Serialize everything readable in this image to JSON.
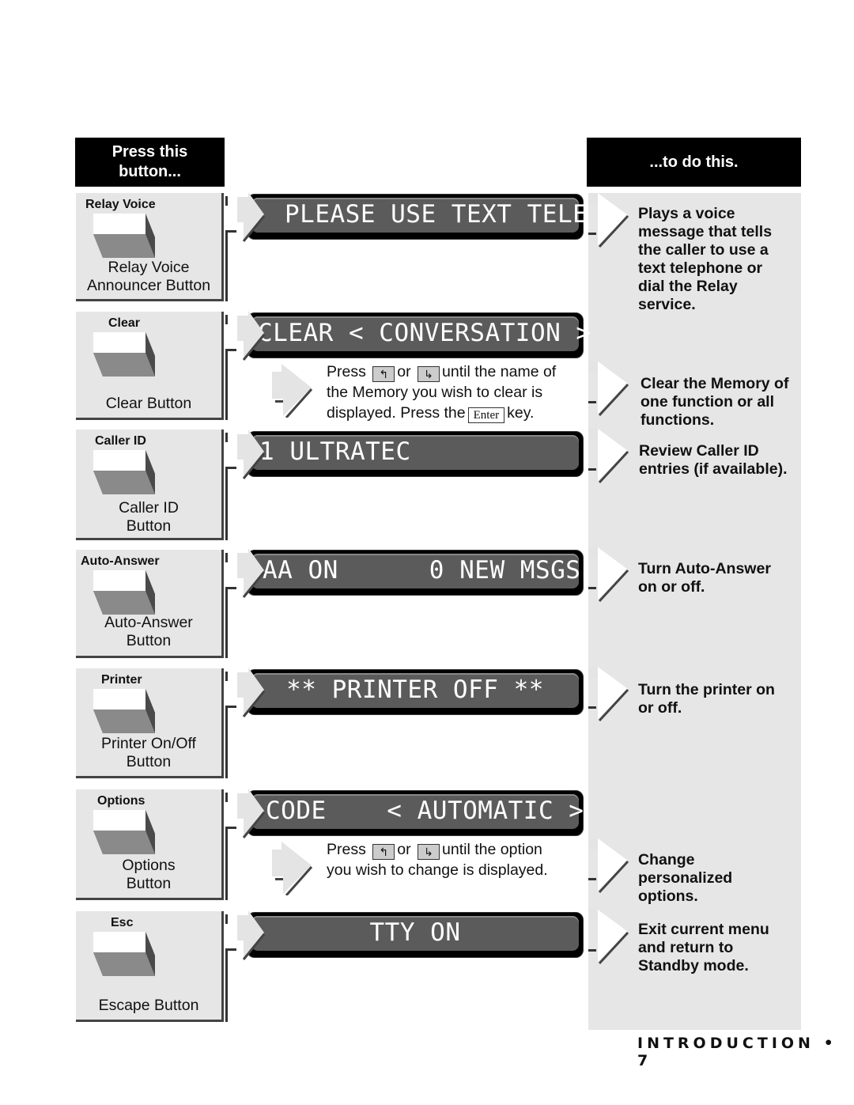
{
  "headers": {
    "left": "Press this button...",
    "right": "...to do this."
  },
  "rows": [
    {
      "key_label": "Relay Voice",
      "button_desc": [
        "Relay Voice",
        "Announcer Button"
      ],
      "display": "PLEASE USE TEXT TELE",
      "action": [
        "Plays a voice",
        "message that tells",
        "the caller to use a",
        "text telephone or",
        "dial the Relay",
        "service."
      ]
    },
    {
      "key_label": "Clear",
      "button_desc": [
        "Clear Button"
      ],
      "display": "CLEAR < CONVERSATION >",
      "instruction": {
        "press": "Press",
        "or": "or",
        "line1_rest": "until the name of",
        "line2": "the Memory you wish to clear is",
        "line3_pre": "displayed. Press the",
        "enter_key": "Enter",
        "line3_post": "key.",
        "up_key_icon": "up-arrow-key-icon",
        "down_key_icon": "down-arrow-key-icon"
      },
      "action": [
        "Clear the Memory of",
        "one function or all",
        "functions."
      ]
    },
    {
      "key_label": "Caller ID",
      "button_desc": [
        "Caller ID",
        "Button"
      ],
      "display": "1 ULTRATEC",
      "action": [
        "Review Caller ID",
        "entries (if available)."
      ]
    },
    {
      "key_label": "Auto-Answer",
      "button_desc": [
        "Auto-Answer",
        "Button"
      ],
      "display": "AA ON      0 NEW MSGS",
      "action": [
        "Turn Auto-Answer",
        "on or off."
      ]
    },
    {
      "key_label": "Printer",
      "button_desc": [
        "Printer On/Off",
        "Button"
      ],
      "display": "** PRINTER OFF **",
      "action": [
        "Turn the printer on",
        "or off."
      ]
    },
    {
      "key_label": "Options",
      "button_desc": [
        "Options",
        "Button"
      ],
      "display": "CODE    < AUTOMATIC >",
      "instruction": {
        "press": "Press",
        "or": "or",
        "line1_rest": "until the option",
        "line2": "you wish to change is displayed.",
        "up_key_icon": "up-arrow-key-icon",
        "down_key_icon": "down-arrow-key-icon"
      },
      "action": [
        "Change",
        "personalized",
        "options."
      ]
    },
    {
      "key_label": "Esc",
      "button_desc": [
        "Escape Button"
      ],
      "display": "TTY ON",
      "action": [
        "Exit current menu",
        "and return to",
        "Standby mode."
      ]
    }
  ],
  "footer": {
    "section": "INTRODUCTION",
    "bullet": "•",
    "page": "7"
  },
  "colors": {
    "header_bg": "#000000",
    "panel_bg": "#e6e6e6",
    "lcd_bg": "#5b5b5b",
    "lcd_text": "#ffffff"
  }
}
